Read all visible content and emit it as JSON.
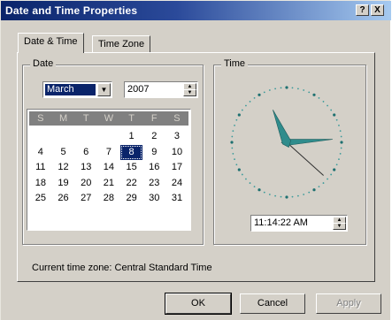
{
  "window": {
    "title": "Date and Time Properties",
    "help_label": "?",
    "close_label": "X"
  },
  "tabs": [
    {
      "label": "Date & Time"
    },
    {
      "label": "Time Zone"
    }
  ],
  "date_group": {
    "label": "Date",
    "month": "March",
    "year": "2007",
    "weekday_headers": [
      "S",
      "M",
      "T",
      "W",
      "T",
      "F",
      "S"
    ],
    "days": [
      "",
      "",
      "",
      "",
      "1",
      "2",
      "3",
      "4",
      "5",
      "6",
      "7",
      "8",
      "9",
      "10",
      "11",
      "12",
      "13",
      "14",
      "15",
      "16",
      "17",
      "18",
      "19",
      "20",
      "21",
      "22",
      "23",
      "24",
      "25",
      "26",
      "27",
      "28",
      "29",
      "30",
      "31"
    ],
    "selected_day": "8"
  },
  "time_group": {
    "label": "Time",
    "time": "11:14:22 AM",
    "clock": {
      "hour": 11,
      "minute": 14,
      "second": 22
    }
  },
  "current_time_zone": "Current time zone:  Central Standard Time",
  "buttons": {
    "ok": "OK",
    "cancel": "Cancel",
    "apply": "Apply"
  },
  "colors": {
    "title_bar": "#0a246a",
    "dialog_face": "#d4d0c8",
    "selection": "#0a246a",
    "clock_hands": "#2f8c8c"
  }
}
